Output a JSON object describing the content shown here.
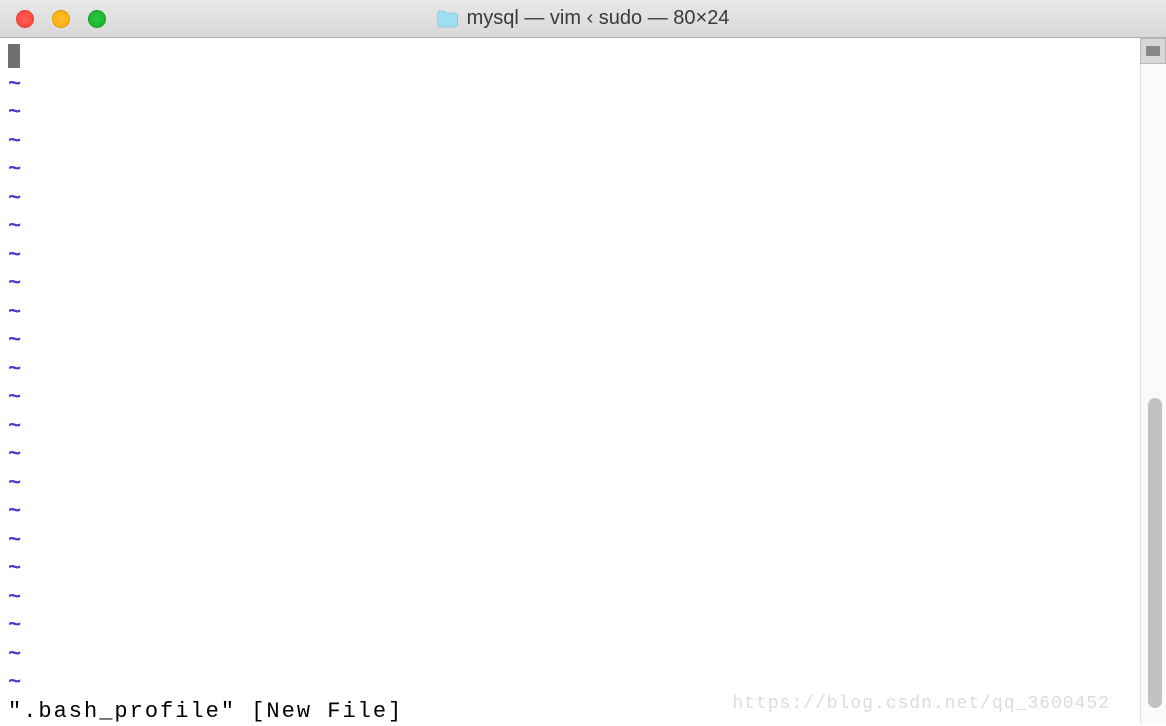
{
  "window": {
    "title": "mysql — vim ‹ sudo — 80×24"
  },
  "editor": {
    "cursor_line": "",
    "tilde": "~",
    "tilde_count": 22,
    "status_line": "\".bash_profile\" [New File]"
  },
  "watermark": "https://blog.csdn.net/qq_3600452"
}
